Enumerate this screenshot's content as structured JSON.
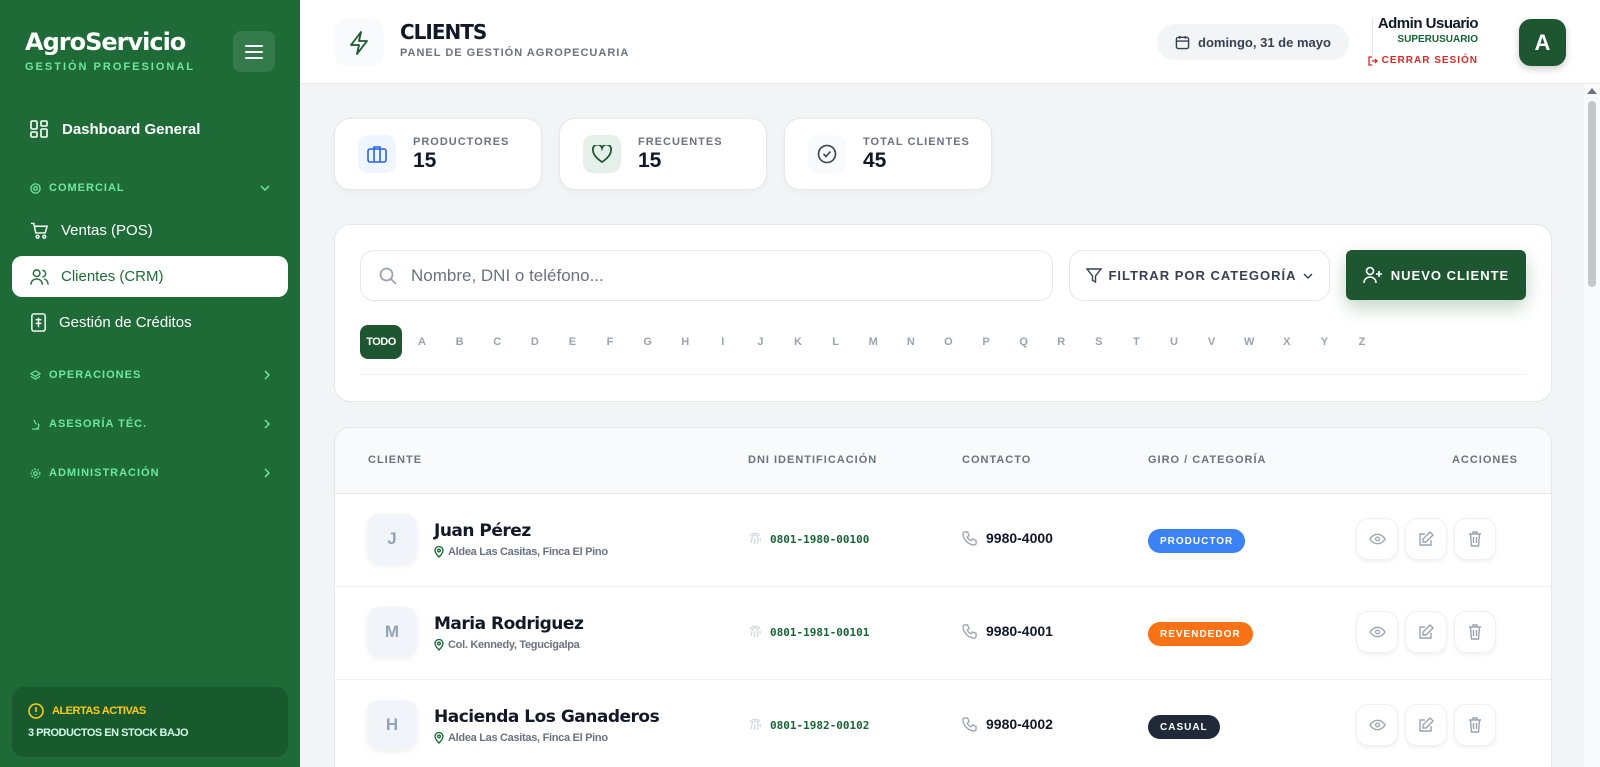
{
  "sidebar": {
    "brand": "AgroServicio",
    "brand_sub": "GESTIÓN PROFESIONAL",
    "dashboard": "Dashboard General",
    "section_comercial": "COMERCIAL",
    "items": [
      {
        "label": "Ventas (POS)",
        "icon": "cart-icon"
      },
      {
        "label": "Clientes (CRM)",
        "icon": "users-icon"
      },
      {
        "label": "Gestión de Créditos",
        "icon": "credit-icon"
      }
    ],
    "section_operaciones": "OPERACIONES",
    "section_asesoria": "ASESORÍA TÉC.",
    "section_administracion": "ADMINISTRACIÓN",
    "alert_title": "ALERTAS ACTIVAS",
    "alert_sub": "3 PRODUCTOS EN STOCK BAJO"
  },
  "header": {
    "title": "CLIENTS",
    "subtitle": "PANEL DE GESTIÓN AGROPECUARIA",
    "date": "domingo, 31 de mayo",
    "user_name": "Admin Usuario",
    "user_role": "SUPERUSUARIO",
    "logout": "CERRAR SESIÓN",
    "avatar": "A"
  },
  "stats": [
    {
      "label": "PRODUCTORES",
      "value": "15",
      "color": "#2563eb"
    },
    {
      "label": "FRECUENTES",
      "value": "15",
      "color": "#166534"
    },
    {
      "label": "TOTAL CLIENTES",
      "value": "45",
      "color": "#374151"
    }
  ],
  "search": {
    "placeholder": "Nombre, DNI o teléfono..."
  },
  "filter": {
    "label": "FILTRAR POR CATEGORÍA"
  },
  "new_client": {
    "label": "NUEVO CLIENTE"
  },
  "alphabet": [
    "TODO",
    "A",
    "B",
    "C",
    "D",
    "E",
    "F",
    "G",
    "H",
    "I",
    "J",
    "K",
    "L",
    "M",
    "N",
    "O",
    "P",
    "Q",
    "R",
    "S",
    "T",
    "U",
    "V",
    "W",
    "X",
    "Y",
    "Z"
  ],
  "table": {
    "headers": {
      "client": "CLIENTE",
      "dni": "DNI IDENTIFICACIÓN",
      "contact": "CONTACTO",
      "category": "GIRO / CATEGORÍA",
      "actions": "ACCIONES"
    },
    "rows": [
      {
        "initial": "J",
        "name": "Juan Pérez",
        "address": "Aldea Las Casitas, Finca El Pino",
        "dni": "0801-1980-00100",
        "phone": "9980-4000",
        "category": "PRODUCTOR",
        "category_color": "#3b82f6"
      },
      {
        "initial": "M",
        "name": "Maria Rodriguez",
        "address": "Col. Kennedy, Tegucigalpa",
        "dni": "0801-1981-00101",
        "phone": "9980-4001",
        "category": "REVENDEDOR",
        "category_color": "#f97316"
      },
      {
        "initial": "H",
        "name": "Hacienda Los Ganaderos",
        "address": "Aldea Las Casitas, Finca El Pino",
        "dni": "0801-1982-00102",
        "phone": "9980-4002",
        "category": "CASUAL",
        "category_color": "#1f2937"
      }
    ]
  }
}
